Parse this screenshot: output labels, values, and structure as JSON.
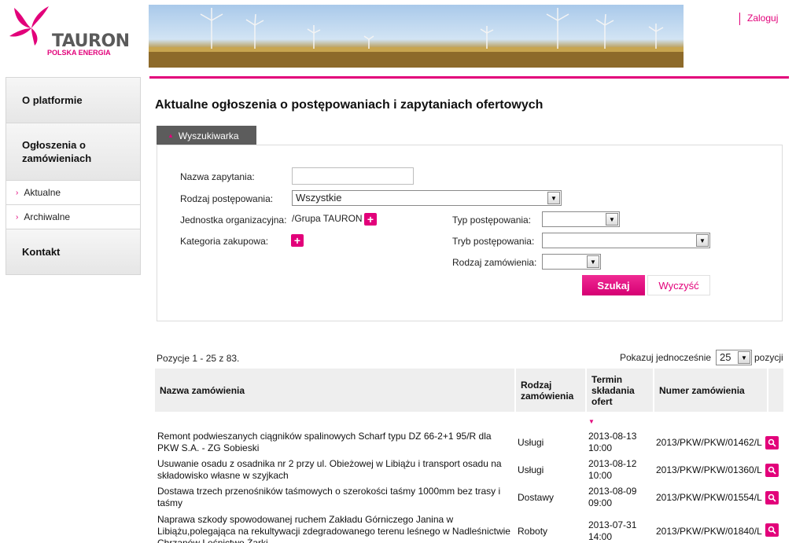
{
  "brand": {
    "name": "TAURON",
    "tagline": "POLSKA ENERGIA",
    "color": "#e2007a"
  },
  "header": {
    "login_label": "Zaloguj"
  },
  "sidebar": {
    "items": [
      {
        "label": "O platformie"
      },
      {
        "label": "Ogłoszenia o zamówieniach"
      },
      {
        "label": "Aktualne"
      },
      {
        "label": "Archiwalne"
      },
      {
        "label": "Kontakt"
      }
    ]
  },
  "page": {
    "title": "Aktualne ogłoszenia o postępowaniach i zapytaniach ofertowych"
  },
  "search": {
    "tab_label": "Wyszukiwarka",
    "name_label": "Nazwa zapytania:",
    "name_value": "",
    "type_label": "Rodzaj postępowania:",
    "type_value": "Wszystkie",
    "unit_label": "Jednostka organizacyjna:",
    "unit_value": "/Grupa TAURON",
    "category_label": "Kategoria zakupowa:",
    "proc_type_label": "Typ postępowania:",
    "proc_type_value": "",
    "proc_mode_label": "Tryb postępowania:",
    "proc_mode_value": "",
    "order_kind_label": "Rodzaj zamówienia:",
    "order_kind_value": "",
    "search_button": "Szukaj",
    "clear_button": "Wyczyść"
  },
  "results": {
    "position_info": "Pozycje 1 -  25 z  83.",
    "per_page_label": "Pokazuj jednocześnie",
    "per_page_value": "25",
    "per_page_suffix": "pozycji",
    "columns": {
      "name": "Nazwa zamówienia",
      "kind": "Rodzaj zamówienia",
      "deadline": "Termin składania ofert",
      "number": "Numer zamówienia"
    },
    "rows": [
      {
        "name": "Remont podwieszanych ciągników spalinowych Scharf typu DZ 66-2+1 95/R dla PKW S.A. - ZG Sobieski",
        "kind": "Usługi",
        "deadline": "2013-08-13 10:00",
        "number": "2013/PKW/PKW/01462/L"
      },
      {
        "name": "Usuwanie osadu z osadnika nr 2 przy ul. Obieżowej w Libiążu i transport osadu na składowisko własne w szyjkach",
        "kind": "Usługi",
        "deadline": "2013-08-12 10:00",
        "number": "2013/PKW/PKW/01360/L"
      },
      {
        "name": "Dostawa trzech przenośników taśmowych o szerokości taśmy 1000mm bez trasy i taśmy",
        "kind": "Dostawy",
        "deadline": "2013-08-09 09:00",
        "number": "2013/PKW/PKW/01554/L"
      },
      {
        "name": "Naprawa szkody spowodowanej ruchem Zakładu Górniczego Janina w Libiążu,polegająca na rekultywacji zdegradowanego terenu leśnego w Nadleśnictwie Chrzanów Leśnictwo Żarki",
        "kind": "Roboty",
        "deadline": "2013-07-31 14:00",
        "number": "2013/PKW/PKW/01840/L"
      }
    ]
  }
}
